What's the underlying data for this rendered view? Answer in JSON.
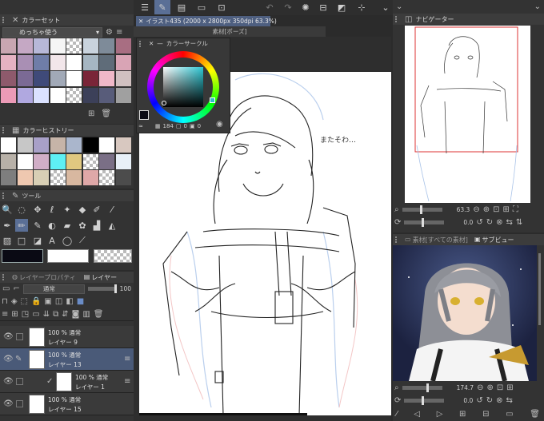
{
  "color_set": {
    "title": "カラーセット",
    "set_name": "めっちゃ使う"
  },
  "color_history": {
    "title": "カラーヒストリー"
  },
  "tool_panel": {
    "title": "ツール"
  },
  "layer_panel": {
    "tab_property": "レイヤープロパティ",
    "tab_layer": "レイヤー",
    "blend_mode": "通常",
    "opacity": "100",
    "layers": [
      {
        "percent": "100 % 通常",
        "name": "レイヤー 9"
      },
      {
        "percent": "100 % 通常",
        "name": "レイヤー 13"
      },
      {
        "percent": "100 % 通常",
        "name": "レイヤー 1"
      },
      {
        "percent": "100 % 通常",
        "name": "レイヤー 15"
      }
    ]
  },
  "document_tab": {
    "label": "イラスト435 (2000 x 2800px 350dpi 63.3%)"
  },
  "material_bar": {
    "label": "素材[ポーズ]"
  },
  "color_circle": {
    "title": "カラーサークル",
    "v1": "184",
    "v2": "0",
    "v3": "0"
  },
  "canvas": {
    "annotation": "またそわ…"
  },
  "navigator": {
    "title": "ナビゲーター",
    "zoom": "63.3",
    "rotate": "0.0"
  },
  "subview": {
    "material_tab": "素材[すべての素材]",
    "title": "サブビュー",
    "zoom": "174.7",
    "rotate": "0.0"
  },
  "colors": {
    "accent": "#6a8cc7",
    "panel": "#333333",
    "selection": "#4a5a78"
  }
}
